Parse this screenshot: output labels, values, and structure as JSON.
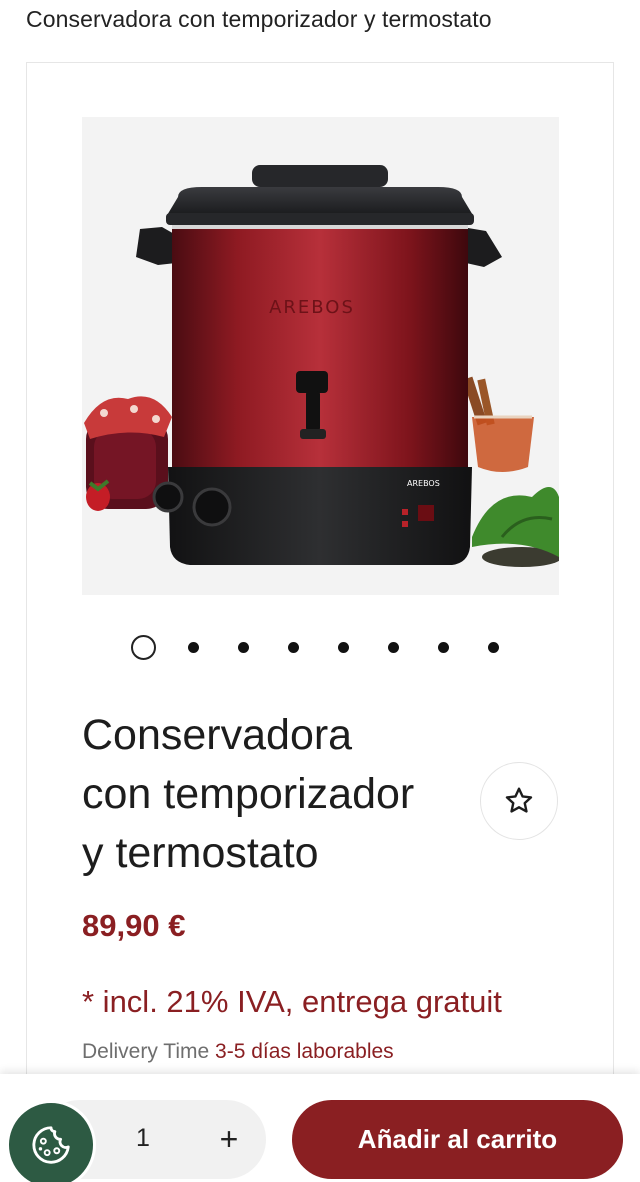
{
  "header": {
    "title": "Conservadora con temporizador y termostato"
  },
  "gallery": {
    "brand_mark": "AREBOS",
    "panel_brand": "AREBOS",
    "slide_count": 8,
    "active_slide": 1
  },
  "product": {
    "title_lines": [
      "Conservadora",
      "con temporizador",
      "y termostato"
    ],
    "price": "89,90 €",
    "tax_note": "* incl. 21% IVA, entrega gratuit",
    "delivery_label": "Delivery Time",
    "delivery_days": "3-5 días laborables"
  },
  "cart": {
    "quantity": "1",
    "plus_label": "+",
    "add_to_cart_label": "Añadir al carrito"
  },
  "icons": {
    "favorite": "star-outline-icon",
    "cookie": "cookie-icon"
  },
  "colors": {
    "accent": "#8a1f22",
    "cookie_button": "#2d5a43",
    "image_background": "#f3f3f3"
  }
}
